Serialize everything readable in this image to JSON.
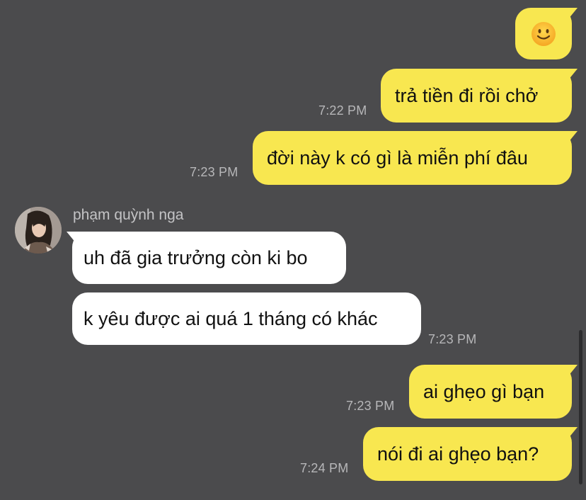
{
  "chat": {
    "contact_name": "phạm quỳnh nga",
    "messages": [
      {
        "from": "me",
        "text": "🙂",
        "time": "",
        "icon": "slightly-smiling-face-icon"
      },
      {
        "from": "me",
        "text": "trả tiền đi rồi chở",
        "time": "7:22 PM"
      },
      {
        "from": "me",
        "text": "đời này k có gì là miễn phí đâu",
        "time": "7:23 PM"
      },
      {
        "from": "them",
        "text": "uh đã gia trưởng còn ki bo",
        "time": ""
      },
      {
        "from": "them",
        "text": "k yêu được ai quá 1 tháng có khác",
        "time": "7:23 PM"
      },
      {
        "from": "me",
        "text": "ai ghẹo gì bạn",
        "time": "7:23 PM"
      },
      {
        "from": "me",
        "text": "nói đi ai ghẹo bạn?",
        "time": "7:24 PM"
      }
    ]
  },
  "colors": {
    "background": "#4b4b4d",
    "my_bubble": "#f8e750",
    "their_bubble": "#ffffff",
    "timestamp": "#b7b7b9"
  }
}
